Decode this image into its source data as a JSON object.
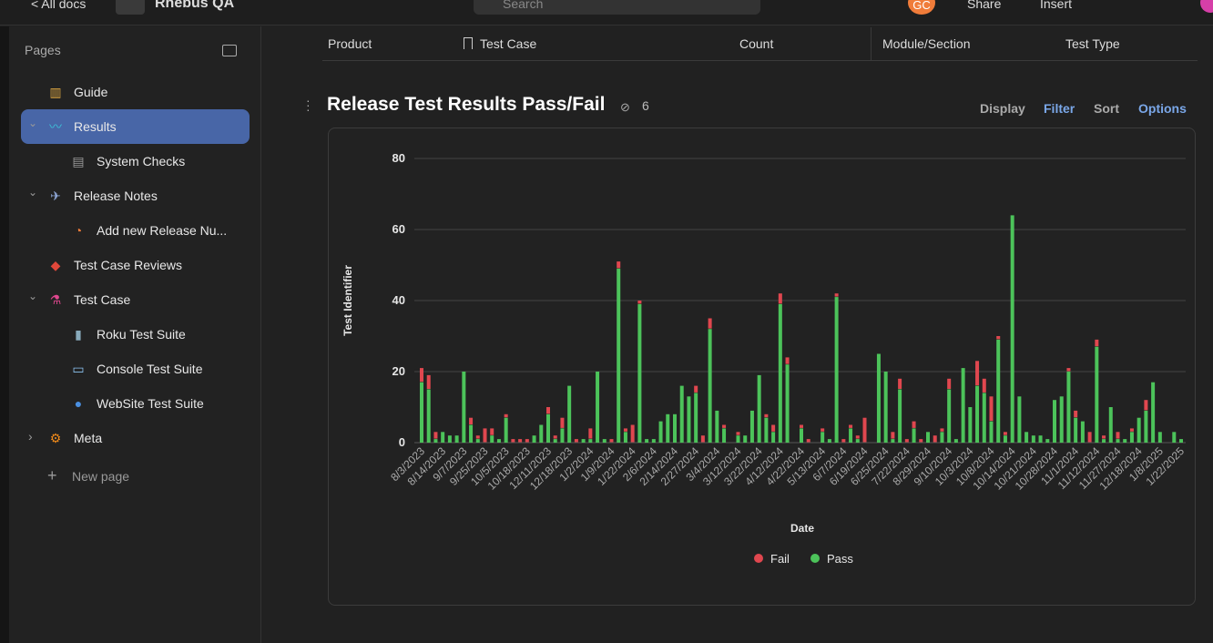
{
  "topbar": {
    "back": "< All docs",
    "doc_title": "Rhebus QA",
    "search_placeholder": "Search",
    "avatar": "GC",
    "share": "Share",
    "insert": "Insert"
  },
  "sidebar": {
    "header": "Pages",
    "items": [
      {
        "label": "Guide",
        "icon": "books-icon",
        "level": 0
      },
      {
        "label": "Results",
        "icon": "chart-line-icon",
        "level": 0,
        "active": true,
        "expanded": true
      },
      {
        "label": "System Checks",
        "icon": "document-icon",
        "level": 1
      },
      {
        "label": "Release Notes",
        "icon": "spaceship-icon",
        "level": 0,
        "expanded": true
      },
      {
        "label": "Add new Release Nu...",
        "icon": "shrimp-icon",
        "level": 1
      },
      {
        "label": "Test Case Reviews",
        "icon": "warning-icon",
        "level": 0
      },
      {
        "label": "Test Case",
        "icon": "flask-icon",
        "level": 0,
        "expanded": true
      },
      {
        "label": "Roku Test Suite",
        "icon": "remote-icon",
        "level": 1
      },
      {
        "label": "Console Test Suite",
        "icon": "window-icon",
        "level": 1
      },
      {
        "label": "WebSite Test Suite",
        "icon": "globe-icon",
        "level": 1
      },
      {
        "label": "Meta",
        "icon": "gears-icon",
        "level": 0,
        "expanded": false
      }
    ],
    "new_page": "New page"
  },
  "table_header": {
    "columns": [
      "Product",
      "Test Case",
      "Count",
      "Module/Section",
      "Test Type"
    ]
  },
  "view": {
    "title": "Release Test Results Pass/Fail",
    "linked_count": "6",
    "controls": [
      "Display",
      "Filter",
      "Sort",
      "Options"
    ]
  },
  "colors": {
    "fail": "#e0474f",
    "pass": "#4cc35a",
    "accent": "#7aa7e8"
  },
  "chart_data": {
    "type": "bar",
    "stacked": true,
    "xlabel": "Date",
    "ylabel": "Test Identifier",
    "ylim": [
      0,
      80
    ],
    "yticks": [
      0,
      20,
      40,
      60,
      80
    ],
    "grid": true,
    "legend": "bottom",
    "x_tick_labels": [
      "8/3/2023",
      "8/14/2023",
      "9/7/2023",
      "9/25/2023",
      "10/5/2023",
      "10/18/2023",
      "12/11/2023",
      "12/18/2023",
      "1/2/2024",
      "1/9/2024",
      "1/22/2024",
      "2/6/2024",
      "2/14/2024",
      "2/27/2024",
      "3/4/2024",
      "3/12/2024",
      "3/22/2024",
      "4/12/2024",
      "4/22/2024",
      "5/13/2024",
      "6/7/2024",
      "6/19/2024",
      "6/25/2024",
      "7/22/2024",
      "8/29/2024",
      "9/10/2024",
      "10/3/2024",
      "10/8/2024",
      "10/14/2024",
      "10/21/2024",
      "10/28/2024",
      "11/1/2024",
      "11/12/2024",
      "11/27/2024",
      "12/18/2024",
      "1/8/2025",
      "1/22/2025"
    ],
    "series": [
      {
        "name": "Fail",
        "values": [
          4,
          4,
          2,
          0,
          0,
          0,
          0,
          2,
          1,
          4,
          2,
          0,
          1,
          1,
          1,
          1,
          0,
          0,
          2,
          1,
          3,
          0,
          1,
          0,
          3,
          0,
          0,
          1,
          2,
          1,
          5,
          1,
          0,
          0,
          0,
          0,
          0,
          0,
          0,
          2,
          2,
          3,
          0,
          1,
          0,
          1,
          0,
          0,
          0,
          1,
          2,
          3,
          2,
          0,
          1,
          1,
          0,
          1,
          0,
          1,
          1,
          1,
          1,
          7,
          0,
          0,
          0,
          2,
          3,
          1,
          2,
          1,
          0,
          2,
          1,
          3,
          0,
          0,
          0,
          7,
          4,
          7,
          1,
          1,
          0,
          0,
          0,
          0,
          0,
          0,
          0,
          0,
          1,
          2,
          0,
          3,
          2,
          1,
          0,
          2,
          0,
          1,
          0,
          3,
          0,
          0,
          0,
          0,
          0
        ]
      },
      {
        "name": "Pass",
        "values": [
          17,
          15,
          1,
          3,
          2,
          2,
          20,
          5,
          1,
          0,
          2,
          1,
          7,
          0,
          0,
          0,
          2,
          5,
          8,
          1,
          4,
          16,
          0,
          1,
          1,
          20,
          1,
          0,
          49,
          3,
          0,
          39,
          1,
          1,
          6,
          8,
          8,
          16,
          13,
          14,
          0,
          32,
          9,
          4,
          0,
          2,
          2,
          9,
          19,
          7,
          3,
          39,
          22,
          0,
          4,
          0,
          0,
          3,
          1,
          41,
          0,
          4,
          1,
          0,
          0,
          25,
          20,
          1,
          15,
          0,
          4,
          0,
          3,
          0,
          3,
          15,
          1,
          21,
          10,
          16,
          14,
          6,
          29,
          2,
          64,
          13,
          3,
          2,
          2,
          1,
          12,
          13,
          20,
          7,
          6,
          0,
          27,
          1,
          10,
          1,
          1,
          3,
          7,
          9,
          17,
          3,
          0,
          3,
          1
        ]
      }
    ]
  }
}
